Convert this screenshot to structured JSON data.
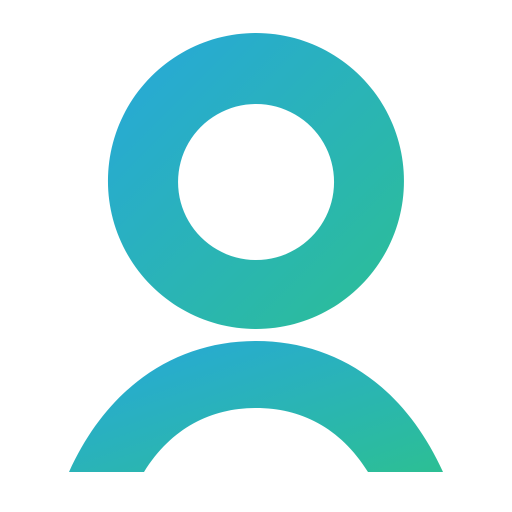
{
  "icon": {
    "name": "user-icon",
    "colors": {
      "gradient_start": "#27a7dc",
      "gradient_end": "#2cbf94",
      "background": "#ffffff"
    }
  }
}
